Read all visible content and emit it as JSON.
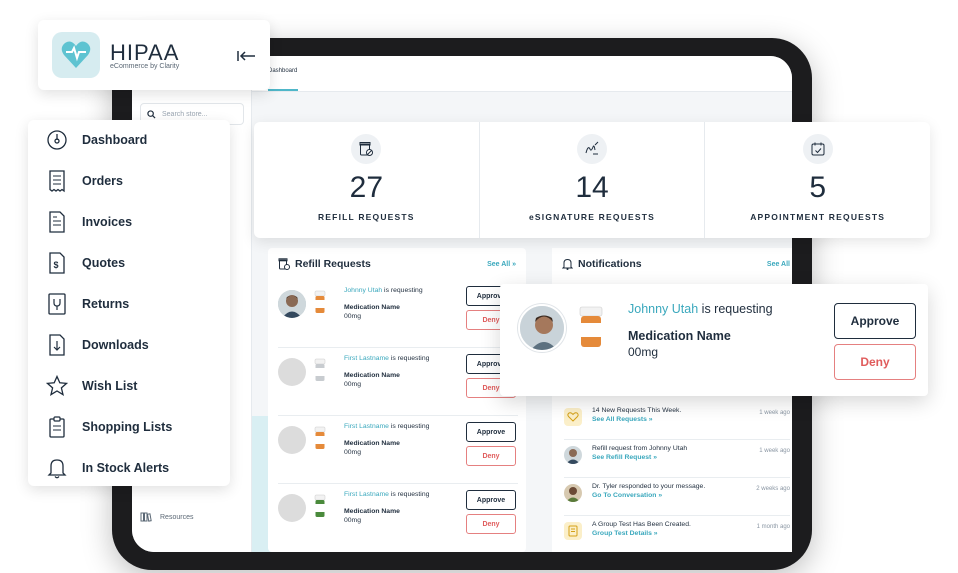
{
  "brand": {
    "title": "HIPAA",
    "subtitle": "eCommerce by Clarity"
  },
  "app": {
    "tab_label": "Dashboard",
    "search_placeholder": "Search store...",
    "resources_label": "Resources"
  },
  "nav": {
    "items": [
      {
        "label": "Dashboard",
        "icon": "speedometer-icon"
      },
      {
        "label": "Orders",
        "icon": "receipt-icon"
      },
      {
        "label": "Invoices",
        "icon": "invoice-icon"
      },
      {
        "label": "Quotes",
        "icon": "quote-icon"
      },
      {
        "label": "Returns",
        "icon": "return-icon"
      },
      {
        "label": "Downloads",
        "icon": "download-icon"
      },
      {
        "label": "Wish List",
        "icon": "star-icon"
      },
      {
        "label": "Shopping Lists",
        "icon": "clipboard-icon"
      },
      {
        "label": "In Stock Alerts",
        "icon": "bell-icon"
      }
    ]
  },
  "stats": [
    {
      "value": "27",
      "label": "REFILL REQUESTS",
      "icon": "prescription-icon"
    },
    {
      "value": "14",
      "label": "eSIGNATURE REQUESTS",
      "icon": "signature-icon"
    },
    {
      "value": "5",
      "label": "APPOINTMENT REQUESTS",
      "icon": "calendar-icon"
    }
  ],
  "refill_panel": {
    "title": "Refill Requests",
    "see_all": "See All »",
    "requests": [
      {
        "name": "Johnny Utah",
        "suffix": " is requesting",
        "medication": "Medication Name",
        "dose": "00mg",
        "approve": "Approve",
        "deny": "Deny"
      },
      {
        "name": "First Lastname",
        "suffix": " is requesting",
        "medication": "Medication Name",
        "dose": "00mg",
        "approve": "Approve",
        "deny": "Deny"
      },
      {
        "name": "First Lastname",
        "suffix": " is requesting",
        "medication": "Medication Name",
        "dose": "00mg",
        "approve": "Approve",
        "deny": "Deny"
      },
      {
        "name": "First Lastname",
        "suffix": " is requesting",
        "medication": "Medication Name",
        "dose": "00mg",
        "approve": "Approve",
        "deny": "Deny"
      }
    ]
  },
  "notifications_panel": {
    "title": "Notifications",
    "see_all": "See All",
    "items": [
      {
        "text": "14 New Requests This Week.",
        "link": "See All Requests »",
        "time": "1 week ago"
      },
      {
        "text": "Refill request from Johnny Utah",
        "link": "See Refill Request »",
        "time": "1 week ago"
      },
      {
        "text": "Dr. Tyler responded to your message.",
        "link": "Go To Conversation »",
        "time": "2 weeks ago"
      },
      {
        "text": "A Group Test Has Been Created.",
        "link": "Group Test Details »",
        "time": "1 month ago"
      }
    ]
  },
  "featured_request": {
    "name": "Johnny Utah",
    "suffix": " is requesting",
    "medication": "Medication Name",
    "dose": "00mg",
    "approve": "Approve",
    "deny": "Deny"
  },
  "colors": {
    "accent": "#3aa8bd",
    "text": "#1f2d3d",
    "deny": "#e05c5c"
  }
}
